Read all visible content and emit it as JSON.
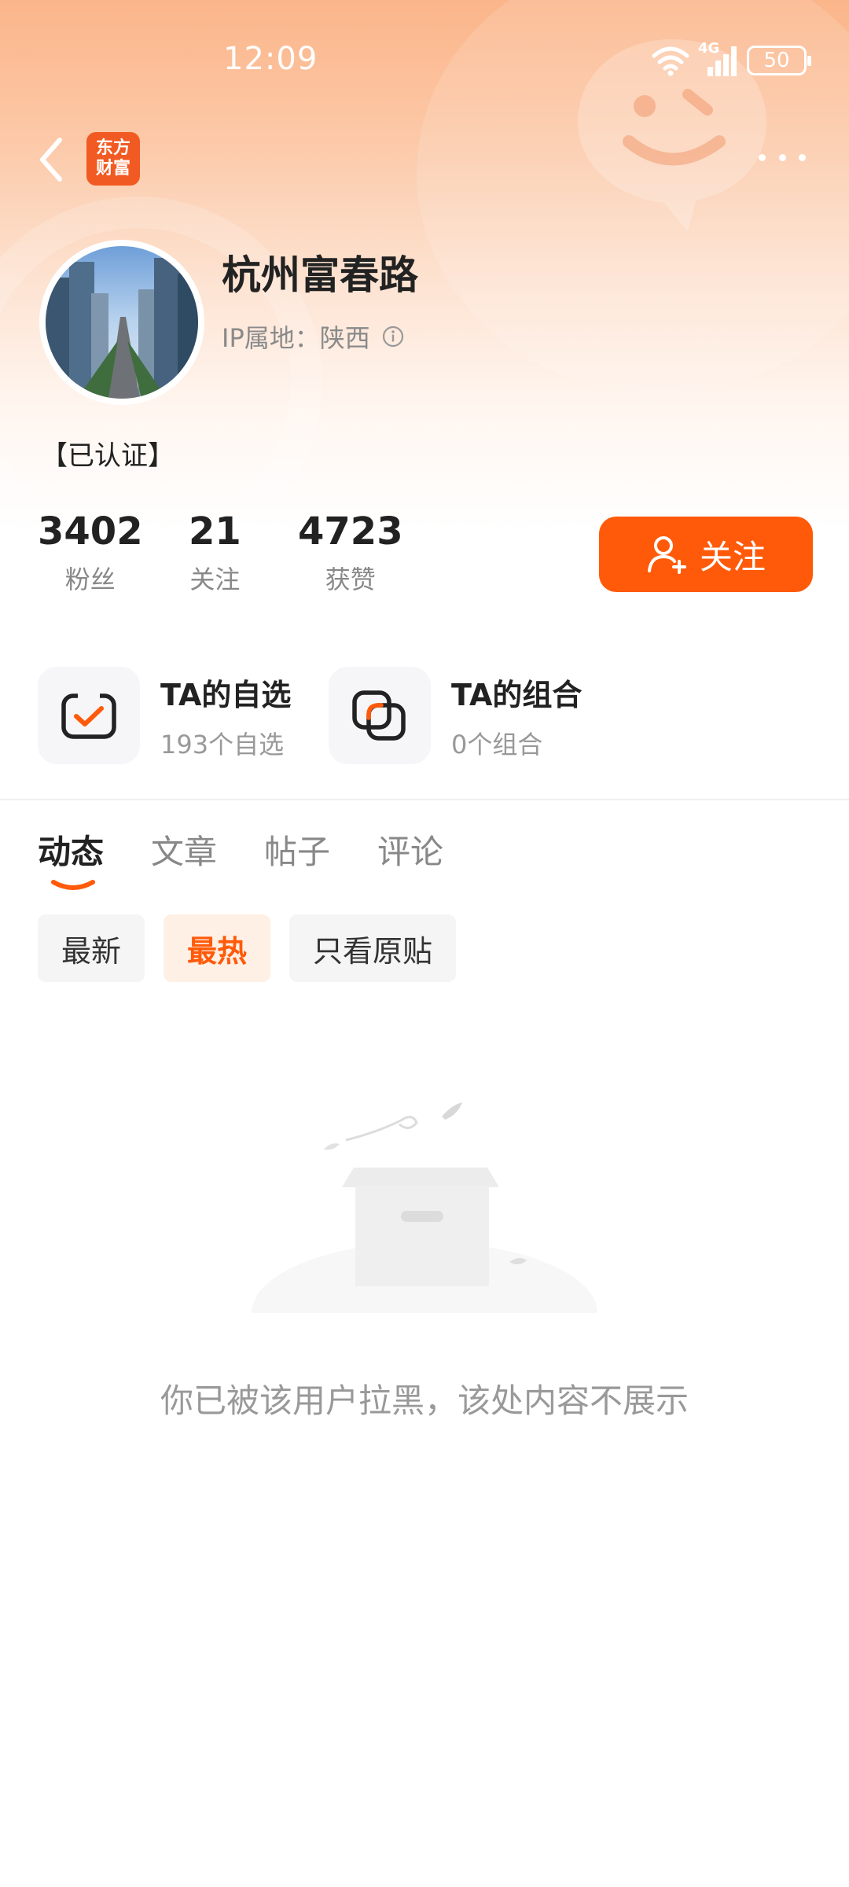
{
  "status_bar": {
    "time": "12:09",
    "network": "4G",
    "battery": "50"
  },
  "header": {
    "back_icon": "chevron-left-icon",
    "app_logo_line1": "东方",
    "app_logo_line2": "财富",
    "more_icon": "more-dots-icon"
  },
  "profile": {
    "name": "杭州富春路",
    "ip_label": "IP属地：",
    "ip_value": "陕西",
    "verified": "【已认证】"
  },
  "stats": [
    {
      "value": "3402",
      "label": "粉丝"
    },
    {
      "value": "21",
      "label": "关注"
    },
    {
      "value": "4723",
      "label": "获赞"
    }
  ],
  "follow_button": {
    "label": "关注"
  },
  "favorites": [
    {
      "title": "TA的自选",
      "subtitle": "193个自选"
    },
    {
      "title": "TA的组合",
      "subtitle": "0个组合"
    }
  ],
  "tabs": [
    {
      "label": "动态",
      "active": true
    },
    {
      "label": "文章",
      "active": false
    },
    {
      "label": "帖子",
      "active": false
    },
    {
      "label": "评论",
      "active": false
    }
  ],
  "filters": [
    {
      "label": "最新",
      "active": false
    },
    {
      "label": "最热",
      "active": true
    },
    {
      "label": "只看原贴",
      "active": false
    }
  ],
  "empty_state": {
    "message": "你已被该用户拉黑，该处内容不展示"
  },
  "colors": {
    "accent": "#ff5a0a",
    "logo_bg": "#f15a22",
    "header_gradient_top": "#fbb58a"
  }
}
